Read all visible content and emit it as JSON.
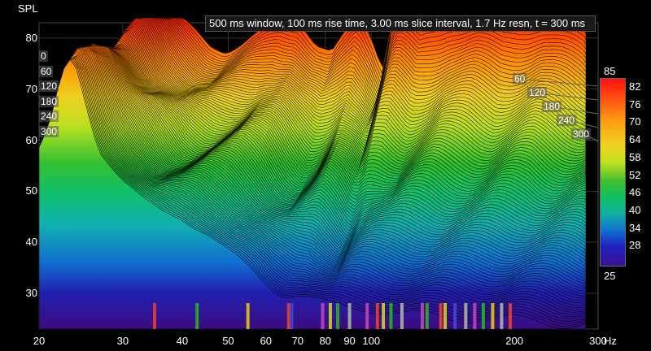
{
  "chart_data": {
    "type": "area",
    "title": "500 ms window, 100 ms rise time, 3.00 ms slice interval, 1.7 Hz resn, t = 300 ms",
    "ylabel": "SPL",
    "xunit": "Hz",
    "xscale": "log",
    "xlim": [
      20,
      300
    ],
    "ylim": [
      23,
      83
    ],
    "grid": true,
    "x_ticks": [
      "20",
      "30",
      "40",
      "50",
      "60",
      "70",
      "80",
      "90",
      "100",
      "200",
      "300"
    ],
    "y_ticks": [
      "30",
      "40",
      "50",
      "60",
      "70",
      "80"
    ],
    "slice_times_ms": [
      "0",
      "60",
      "120",
      "180",
      "240",
      "300"
    ],
    "left_slice_labels": [
      "0",
      "60",
      "120",
      "180",
      "240",
      "300"
    ],
    "colorbar": {
      "min_label": "25",
      "max_label": "85",
      "ticks": [
        "82",
        "76",
        "70",
        "64",
        "58",
        "52",
        "46",
        "40",
        "34",
        "28"
      ]
    },
    "front_slice_300ms": {
      "x": [
        20,
        21,
        22,
        23,
        24,
        25,
        26,
        27,
        28,
        30,
        33,
        36,
        40,
        45,
        50,
        55,
        60,
        65,
        70,
        75,
        80,
        90,
        100,
        120,
        150,
        200,
        250,
        300
      ],
      "y": [
        58,
        62,
        70,
        76,
        74,
        68,
        62,
        58,
        56,
        52,
        48,
        46,
        45,
        42,
        38,
        35,
        32,
        30,
        30,
        29,
        28,
        27,
        27,
        26,
        25,
        25,
        24,
        24
      ]
    },
    "back_slice_0ms": {
      "x": [
        24,
        26,
        28,
        30,
        33,
        36,
        40,
        45,
        50,
        55,
        60,
        65,
        70,
        75,
        80,
        85,
        90,
        95,
        100,
        110,
        120,
        140,
        160,
        180,
        200,
        230,
        260,
        300
      ],
      "y": [
        82,
        78,
        76,
        74,
        73,
        74,
        76,
        79,
        79,
        74,
        72,
        76,
        80,
        76,
        70,
        80,
        82,
        80,
        78,
        80,
        82,
        82,
        80,
        81,
        82,
        80,
        78,
        76
      ]
    },
    "resonance_markers": [
      {
        "x": 35,
        "color": "#d43a3a"
      },
      {
        "x": 43,
        "color": "#2aa02a"
      },
      {
        "x": 55,
        "color": "#d0b020"
      },
      {
        "x": 67,
        "color": "#d43a3a"
      },
      {
        "x": 68,
        "color": "#4040d0"
      },
      {
        "x": 79,
        "color": "#b040b0"
      },
      {
        "x": 82,
        "color": "#c0c020"
      },
      {
        "x": 85,
        "color": "#2aa02a"
      },
      {
        "x": 90,
        "color": "#a0a0a0"
      },
      {
        "x": 98,
        "color": "#b040b0"
      },
      {
        "x": 103,
        "color": "#d43a3a"
      },
      {
        "x": 106,
        "color": "#c0c020"
      },
      {
        "x": 110,
        "color": "#2aa02a"
      },
      {
        "x": 116,
        "color": "#a0a0a0"
      },
      {
        "x": 128,
        "color": "#b040b0"
      },
      {
        "x": 131,
        "color": "#2aa02a"
      },
      {
        "x": 140,
        "color": "#d43a3a"
      },
      {
        "x": 143,
        "color": "#c0c020"
      },
      {
        "x": 150,
        "color": "#4040d0"
      },
      {
        "x": 158,
        "color": "#a0a0a0"
      },
      {
        "x": 165,
        "color": "#b040b0"
      },
      {
        "x": 172,
        "color": "#2aa02a"
      },
      {
        "x": 180,
        "color": "#d0b020"
      },
      {
        "x": 188,
        "color": "#a0a0a0"
      },
      {
        "x": 196,
        "color": "#d43a3a"
      }
    ]
  }
}
